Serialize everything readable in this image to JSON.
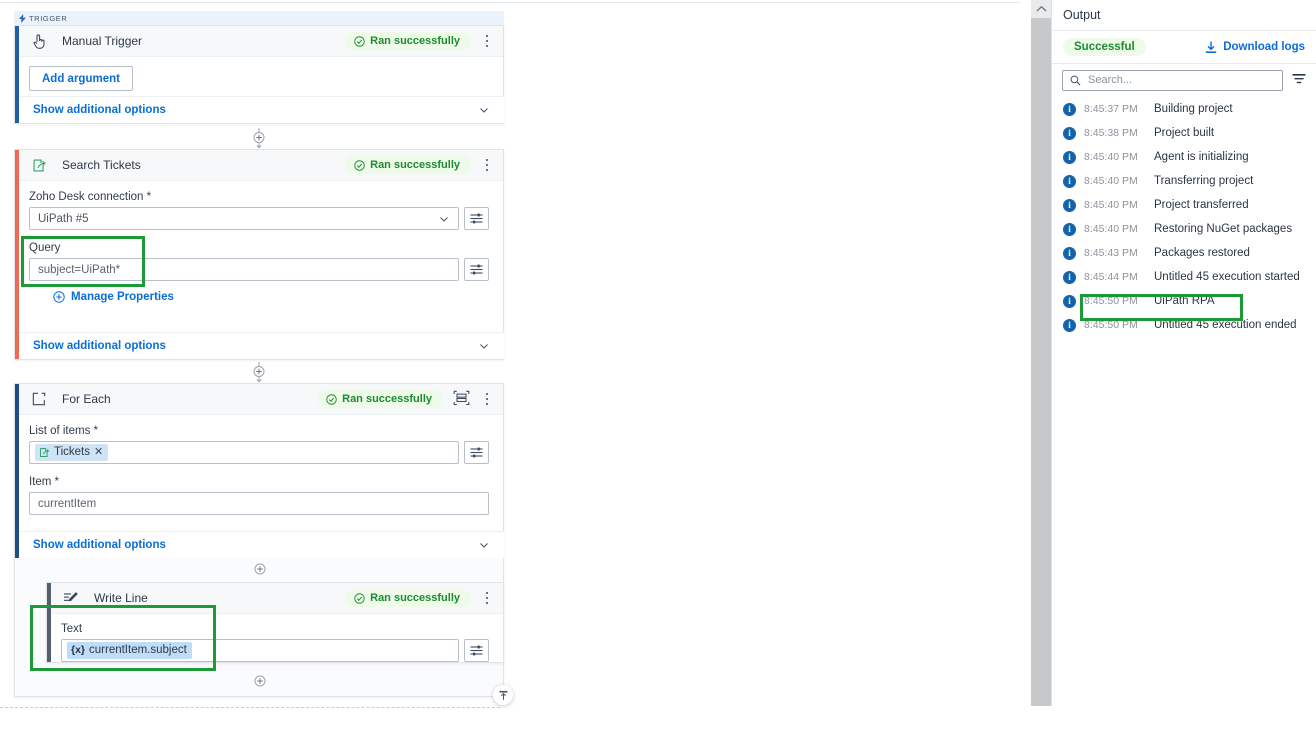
{
  "canvas": {
    "trigger_label": "TRIGGER",
    "status_text": "Ran successfully",
    "cards": [
      {
        "id": "manual-trigger",
        "title": "Manual Trigger",
        "icon": "manual-trigger-icon",
        "accent": "#1f5fa8",
        "status": "Ran successfully",
        "add_argument_label": "Add argument",
        "show_options_label": "Show additional options"
      },
      {
        "id": "search-tickets",
        "title": "Search Tickets",
        "icon": "zoho-desk-icon",
        "accent": "#ef6a54",
        "status": "Ran successfully",
        "connection_label": "Zoho Desk connection *",
        "connection_value": "UiPath #5",
        "query_label": "Query",
        "query_value": "subject=UiPath*",
        "manage_properties_label": "Manage Properties",
        "show_options_label": "Show additional options"
      },
      {
        "id": "for-each",
        "title": "For Each",
        "icon": "for-each-icon",
        "accent": "#1f4e87",
        "status": "Ran successfully",
        "list_label": "List of items *",
        "list_chip": "Tickets",
        "item_label": "Item *",
        "item_value": "currentItem",
        "show_options_label": "Show additional options"
      },
      {
        "id": "write-line",
        "title": "Write Line",
        "icon": "write-line-icon",
        "accent": "#55606e",
        "status": "Ran successfully",
        "text_label": "Text",
        "text_expression": "currentItem.subject",
        "expression_prefix": "{x}"
      }
    ]
  },
  "output": {
    "title": "Output",
    "status_pill": "Successful",
    "download_logs_label": "Download logs",
    "search_placeholder": "Search...",
    "logs": [
      {
        "time": "8:45:37 PM",
        "message": "Building project",
        "level": "info"
      },
      {
        "time": "8:45:38 PM",
        "message": "Project built",
        "level": "info"
      },
      {
        "time": "8:45:40 PM",
        "message": "Agent is initializing",
        "level": "info"
      },
      {
        "time": "8:45:40 PM",
        "message": "Transferring project",
        "level": "info"
      },
      {
        "time": "8:45:40 PM",
        "message": "Project transferred",
        "level": "info"
      },
      {
        "time": "8:45:40 PM",
        "message": "Restoring NuGet packages",
        "level": "info"
      },
      {
        "time": "8:45:43 PM",
        "message": "Packages restored",
        "level": "info"
      },
      {
        "time": "8:45:44 PM",
        "message": "Untitled 45 execution started",
        "level": "info"
      },
      {
        "time": "8:45:50 PM",
        "message": "UiPath RPA",
        "level": "info"
      },
      {
        "time": "8:45:50 PM",
        "message": "Untitled 45 execution ended",
        "level": "info"
      }
    ],
    "highlighted_log_index": 8
  },
  "colors": {
    "accent_blue": "#0b6dd8",
    "success_green": "#1f8a33",
    "success_bg": "#edfbe8",
    "highlight_green": "#1c9a35",
    "info_blue": "#1463ad"
  }
}
